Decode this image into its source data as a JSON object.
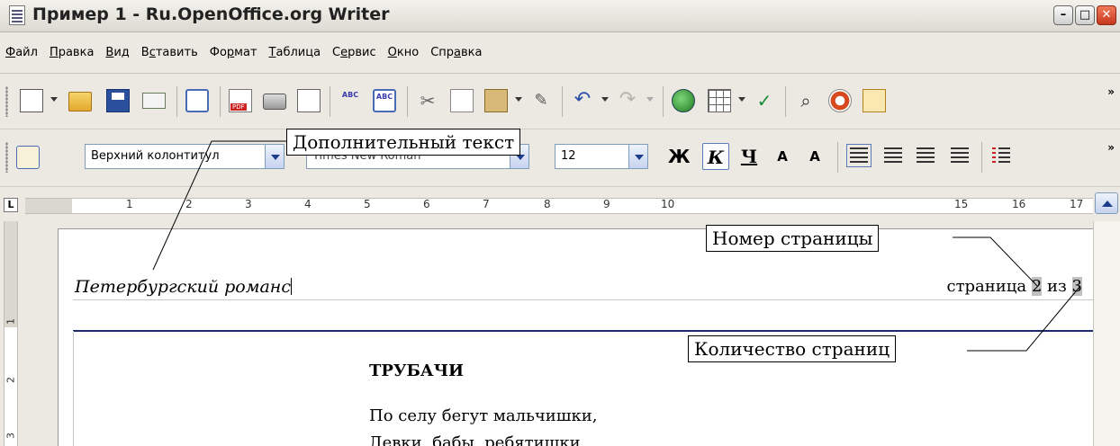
{
  "window": {
    "title": "Пример 1 - Ru.OpenOffice.org Writer",
    "controls": {
      "minimize": "–",
      "maximize": "□",
      "close": "✕"
    }
  },
  "menu": {
    "items": [
      {
        "accel": "Ф",
        "rest": "айл"
      },
      {
        "accel": "П",
        "rest": "равка"
      },
      {
        "accel": "В",
        "rest": "ид"
      },
      {
        "pre": "В",
        "accel": "с",
        "rest": "тавить"
      },
      {
        "pre": "Фо",
        "accel": "р",
        "rest": "мат"
      },
      {
        "accel": "Т",
        "rest": "аблица"
      },
      {
        "pre": "С",
        "accel": "е",
        "rest": "рвис"
      },
      {
        "accel": "О",
        "rest": "кно"
      },
      {
        "pre": "Спр",
        "accel": "а",
        "rest": "вка"
      }
    ]
  },
  "toolbar": {
    "overflow": "»",
    "paragraph_style": "Верхний колонтитул",
    "font_name": "Times New Roman",
    "font_size": "12",
    "bold_label": "Ж",
    "italic_label": "К",
    "underline_label": "Ч",
    "superscript_label": "A",
    "subscript_label": "A"
  },
  "ruler": {
    "corner": "L",
    "ticks": [
      "1",
      "2",
      "3",
      "4",
      "5",
      "6",
      "7",
      "8",
      "9",
      "10",
      "15",
      "16",
      "17"
    ],
    "vticks": [
      "1",
      "2",
      "3"
    ]
  },
  "document": {
    "header_left": "Петербургский романс",
    "header_page_prefix": "страница ",
    "header_page_number": "2",
    "header_page_of": " из ",
    "header_page_count": "3",
    "poem_title": "ТРУБАЧИ",
    "poem_lines": [
      "По селу бегут мальчишки,",
      "Девки, бабы, ребятишки,"
    ]
  },
  "callouts": {
    "extra_text": "Дополнительный текст",
    "page_number": "Номер страницы",
    "page_count": "Количество страниц"
  }
}
